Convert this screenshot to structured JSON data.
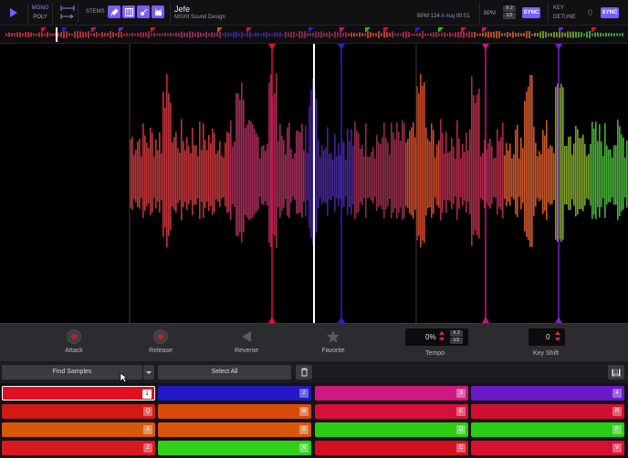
{
  "header": {
    "mode_mono": "MONO",
    "mode_poly": "POLY",
    "stems_label": "STEMS",
    "track_title": "Jefe",
    "track_artist": "MSXII Sound Design",
    "bpm_text": "BPM 124",
    "key_text": "A maj",
    "time_text": "00:01",
    "bpm_label": "BPM",
    "x2": "X 2",
    "half": "1/2",
    "sync": "SYNC",
    "key_label": "KEY",
    "detune_label": "DETUNE",
    "detune_value": "0",
    "key_sync": "SYNC",
    "accent": "#7b5cff"
  },
  "controls": {
    "attack": "Attack",
    "release": "Release",
    "reverse": "Reverse",
    "favorite": "Favorite",
    "tempo_value": "0%",
    "tempo_x2": "X 2",
    "tempo_half": "1/2",
    "tempo": "Tempo",
    "keyshift_value": "0",
    "keyshift": "Key Shift"
  },
  "toolbar": {
    "find_samples": "Find Samples",
    "select_all": "Select All"
  },
  "pads": [
    {
      "key": "1",
      "color": "#e01020",
      "selected": true
    },
    {
      "key": "2",
      "color": "#2418c8"
    },
    {
      "key": "3",
      "color": "#d01880"
    },
    {
      "key": "4",
      "color": "#6a18c8"
    },
    {
      "key": "Q",
      "color": "#d21a14"
    },
    {
      "key": "W",
      "color": "#d64a0c"
    },
    {
      "key": "E",
      "color": "#d6103a"
    },
    {
      "key": "R",
      "color": "#d01030"
    },
    {
      "key": "A",
      "color": "#d8580a"
    },
    {
      "key": "S",
      "color": "#d8560c"
    },
    {
      "key": "D",
      "color": "#2ccc14"
    },
    {
      "key": "F",
      "color": "#2ccc14"
    },
    {
      "key": "Z",
      "color": "#d81820"
    },
    {
      "key": "X",
      "color": "#30d014"
    },
    {
      "key": "C",
      "color": "#d41020"
    },
    {
      "key": "V",
      "color": "#d81030"
    }
  ]
}
